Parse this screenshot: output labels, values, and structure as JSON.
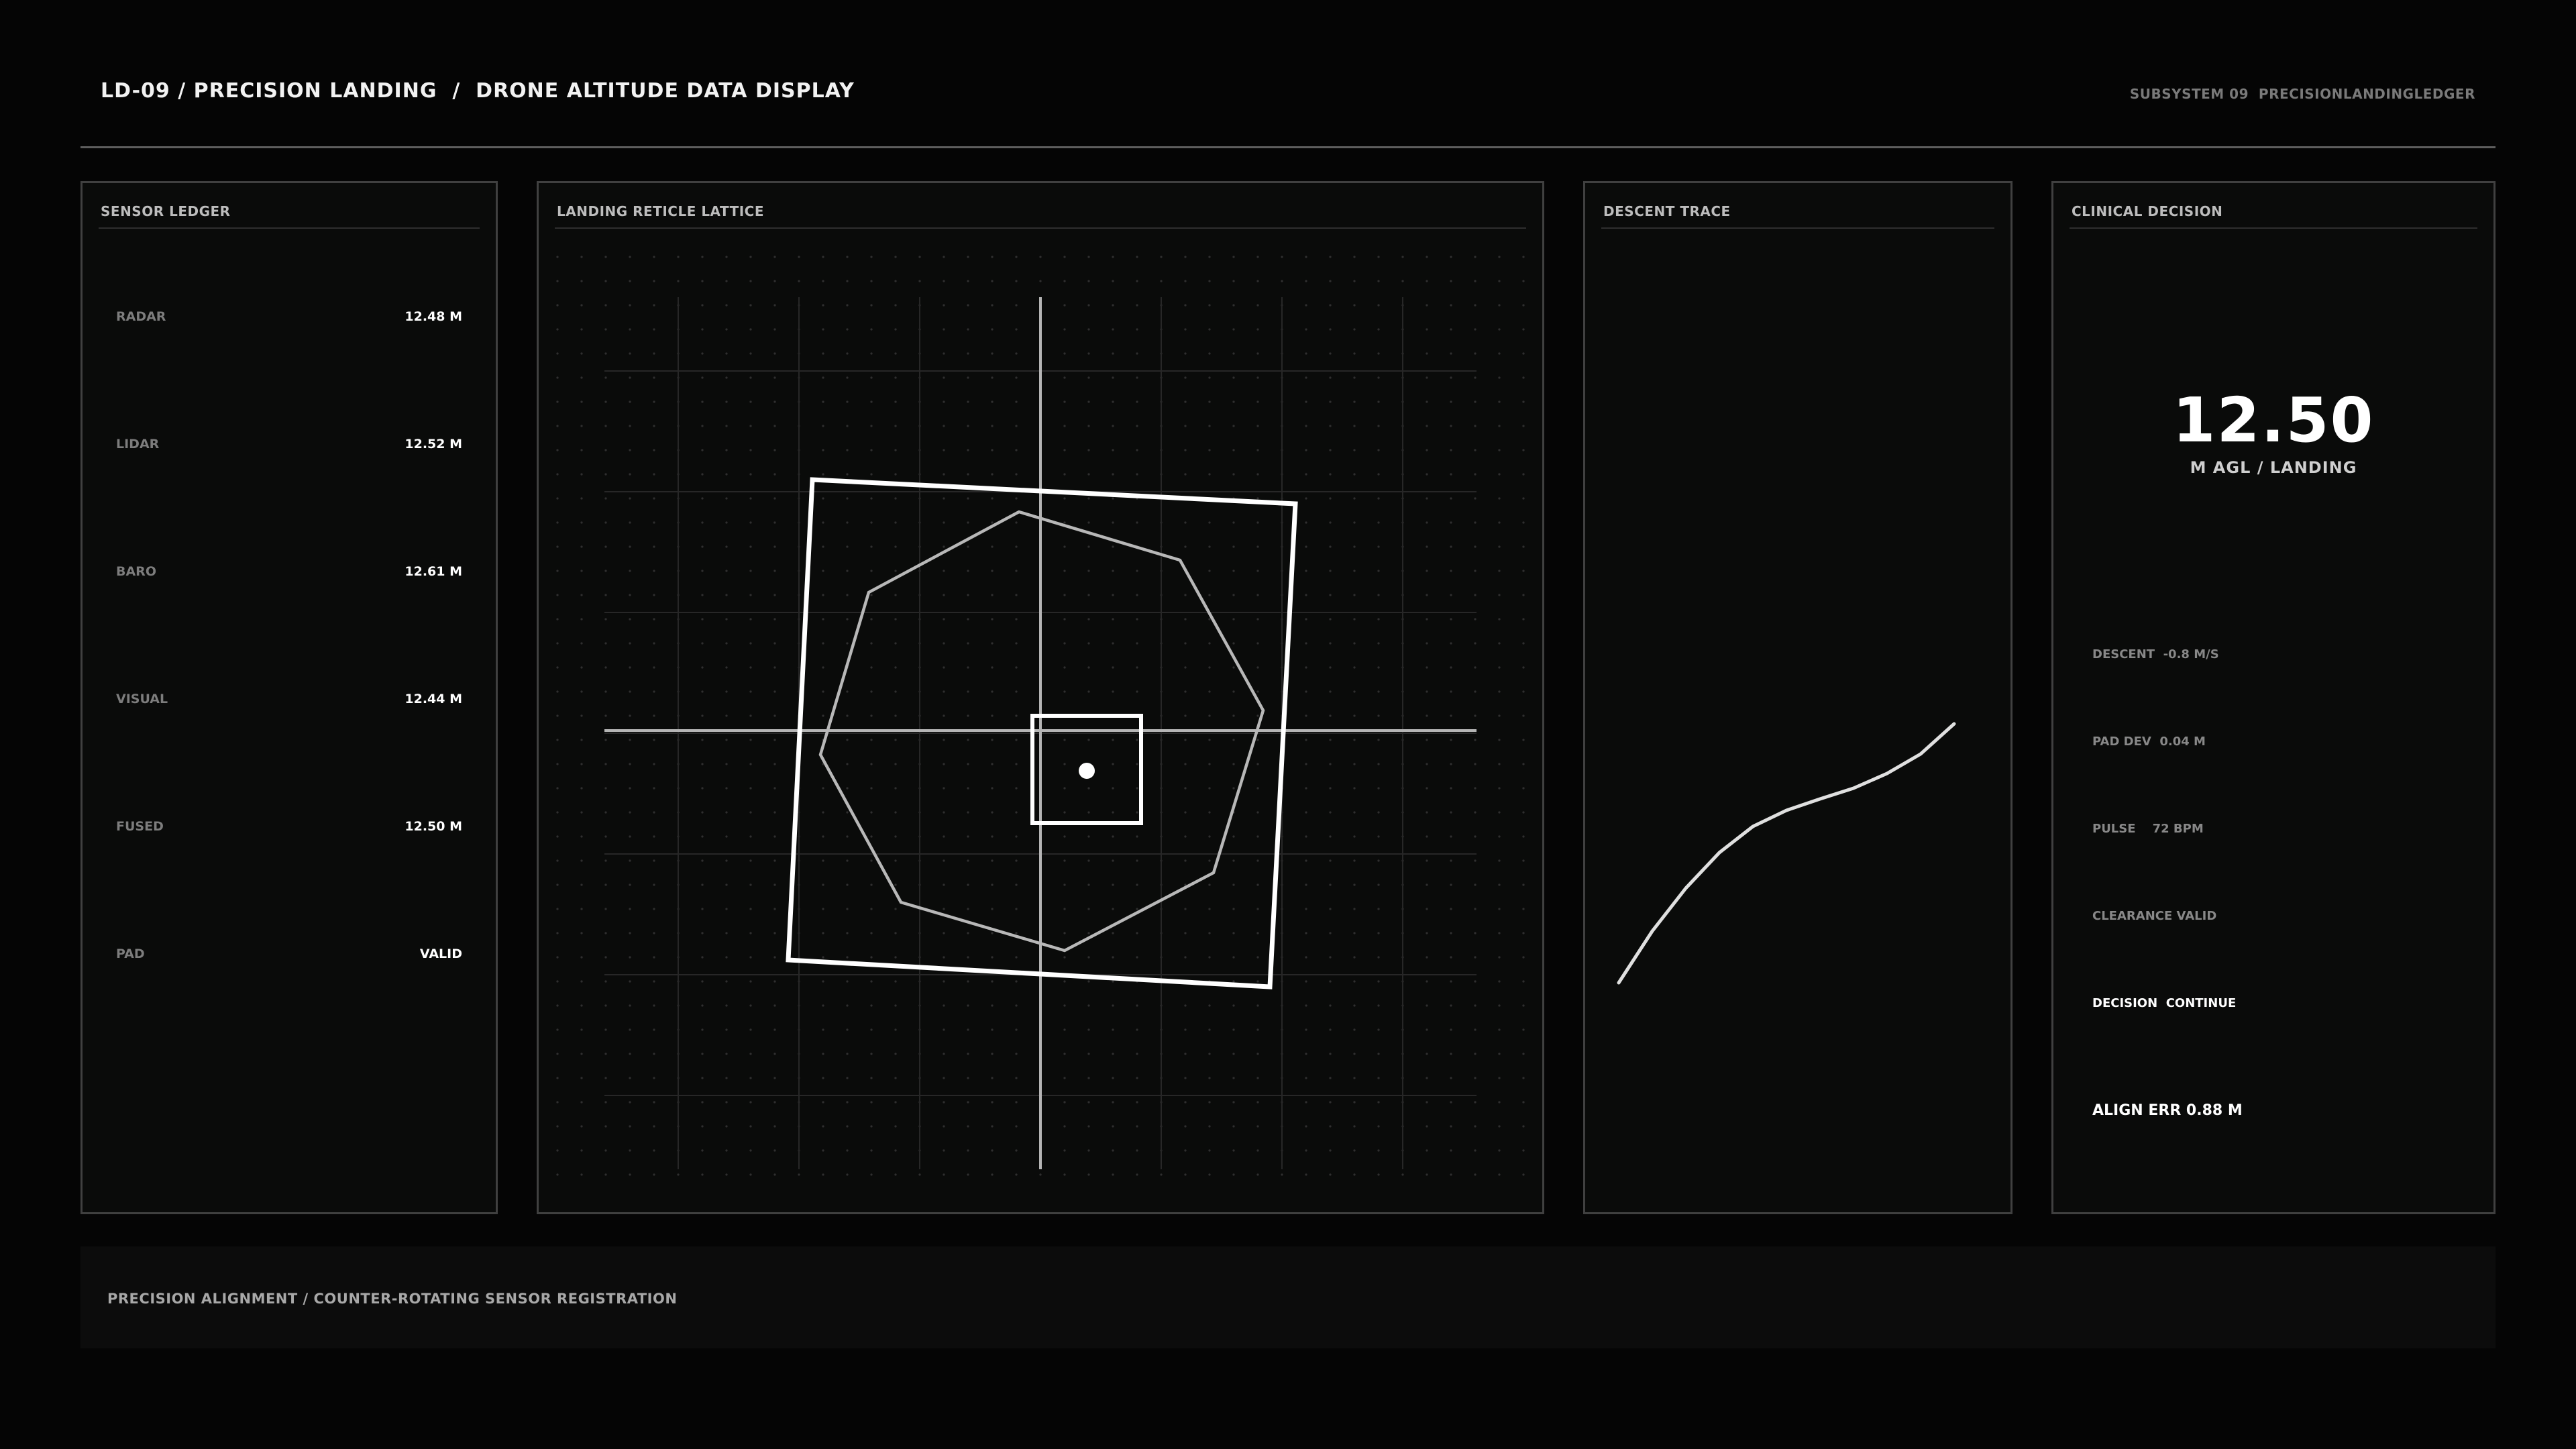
{
  "header": {
    "title": "LD-09 / PRECISION LANDING  /  DRONE ALTITUDE DATA DISPLAY",
    "subsystem": "SUBSYSTEM 09  PRECISIONLANDINGLEDGER"
  },
  "sensor_ledger": {
    "title": "SENSOR LEDGER",
    "rows": [
      {
        "label": "RADAR",
        "value": "12.48 M"
      },
      {
        "label": "LIDAR",
        "value": "12.52 M"
      },
      {
        "label": "BARO",
        "value": "12.61 M"
      },
      {
        "label": "VISUAL",
        "value": "12.44 M"
      },
      {
        "label": "FUSED",
        "value": "12.50 M"
      },
      {
        "label": "PAD",
        "value": "VALID"
      }
    ]
  },
  "reticle": {
    "title": "LANDING RETICLE LATTICE"
  },
  "descent_trace": {
    "title": "DESCENT TRACE"
  },
  "decision": {
    "title": "CLINICAL DECISION",
    "altitude_value": "12.50",
    "altitude_unit": "M AGL / LANDING",
    "stats": [
      "DESCENT  -0.8 M/S",
      "PAD DEV  0.04 M",
      "PULSE    72 BPM",
      "CLEARANCE VALID",
      "DECISION  CONTINUE"
    ],
    "align_error": "ALIGN ERR 0.88 M"
  },
  "footer": {
    "caption": "PRECISION ALIGNMENT / COUNTER-ROTATING SENSOR REGISTRATION"
  },
  "colors": {
    "background": "#050505",
    "panel": "#0a0b0a",
    "border": "#404040",
    "accent": "#ffffff"
  }
}
